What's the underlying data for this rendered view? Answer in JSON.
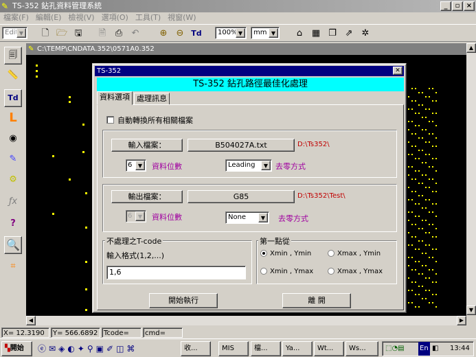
{
  "app": {
    "title": "TS-352 鉆孔資料管理系統",
    "menu": [
      "檔案(F)",
      "編輯(E)",
      "檢視(V)",
      "選項(O)",
      "工具(T)",
      "視窗(W)"
    ],
    "edit_mode": "Edit",
    "zoom": "100%",
    "unit": "mm",
    "td_label": "Td"
  },
  "document": {
    "title": "C:\\TEMP\\CNDATA.352\\0571A0.352"
  },
  "dialog": {
    "window_title": "TS-352",
    "header": "TS-352  鉆孔路徑最佳化處理",
    "tabs": [
      "資料選項",
      "處理訊息"
    ],
    "auto_convert_label": "自動轉換所有相關檔案",
    "input": {
      "button": "輸入檔案：",
      "filename": "B504027A.txt",
      "path": "D:\\Ts352\\",
      "digits_value": "6",
      "digits_label": "資料位數",
      "zero_value": "Leading",
      "zero_label": "去零方式"
    },
    "output": {
      "button": "輸出檔案：",
      "filename": "G85",
      "path": "D:\\Ts352\\Test\\",
      "digits_value": "6",
      "digits_label": "資料位數",
      "zero_value": "None",
      "zero_label": "去零方式"
    },
    "tcode": {
      "group_label": "不處理之T-code",
      "format_label": "輸入格式(1,2,...)",
      "value": "1,6"
    },
    "first_point": {
      "group_label": "第一點從",
      "options": [
        "Xmin , Ymin",
        "Xmax , Ymin",
        "Xmin , Ymax",
        "Xmax , Ymax"
      ],
      "selected": "Xmin , Ymin"
    },
    "start_button": "開始執行",
    "exit_button": "離 開"
  },
  "status": {
    "x": "X= 12.3190",
    "y": "Y= 566.6892",
    "tcode": "Tcode=",
    "cmd": "cmd="
  },
  "taskbar": {
    "start": "開始",
    "tasks": [
      "收...",
      "MIS",
      "檔...",
      "Ya...",
      "Wt...",
      "Ws..."
    ],
    "tray_lang": "En",
    "clock": "13:44"
  }
}
